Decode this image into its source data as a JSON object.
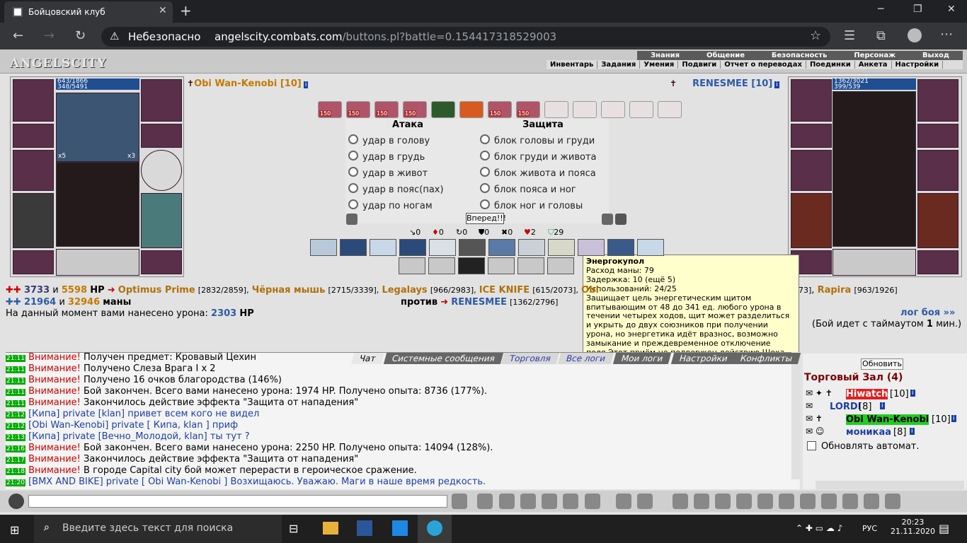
{
  "browser": {
    "tab_title": "Бойцовский клуб",
    "omnibox_security": "Небезопасно",
    "url_host": "angelscity.combats.com",
    "url_path": "/buttons.pl?battle=0.154417318529003"
  },
  "game": {
    "logo": "ANGELSCITY",
    "menu_top": [
      "Знания",
      "Общение",
      "Безопасность",
      "Персонаж",
      "Выход"
    ],
    "menu_sub": [
      "Инвентарь",
      "Задания",
      "Умения",
      "Подвиги",
      "Отчет о переводах",
      "Поединки",
      "Анкета",
      "Настройки"
    ]
  },
  "player": {
    "hp": "643/1866",
    "mana": "348/5491",
    "name": "Obi Wan-Kenobi [10]",
    "slot_count_a": "x5",
    "slot_count_b": "x3"
  },
  "enemy": {
    "hp": "1362/3021",
    "mana": "399/539",
    "name": "RENESMEE [10]"
  },
  "scroll_counts": [
    "150",
    "150",
    "150",
    "150",
    "150",
    "150"
  ],
  "attack": {
    "title": "Атака",
    "options": [
      "удар в голову",
      "удар в грудь",
      "удар в живот",
      "удар в пояс(пах)",
      "удар по ногам"
    ]
  },
  "defense": {
    "title": "Защита",
    "options": [
      "блок головы и груди",
      "блок груди и живота",
      "блок живота и пояса",
      "блок пояса и ног",
      "блок ног и головы"
    ]
  },
  "go_button": "Вперед!!!",
  "stats": [
    "0",
    "0",
    "0",
    "0",
    "0",
    "2",
    "29"
  ],
  "tooltip": {
    "title": "Энергокупол",
    "mana": "Расход маны: 79",
    "delay": "Задержка: 10 (ещё 5)",
    "uses": "Использований: 24/25",
    "desc": "Защищает цель энергетическим щитом впитывающим от 48 до 341 ед. любого урона в течении четырех ходов, щит может разделиться и укрыть до двух союзников при получении урона, но энергетика идёт вразнос, возможно замыкание и преждевременное отключение поля.Этот приём не подвержен действию Шока."
  },
  "team": {
    "hp_sum": "3733",
    "hp_sum2": "5598",
    "hp_unit": "HP",
    "mana_sum": "21964",
    "mana_sum2": "32946",
    "mana_unit": "маны",
    "and": "и",
    "members": [
      {
        "n": "Optimus Prime",
        "v": "[2832/2859],"
      },
      {
        "n": "Чёрная мышь",
        "v": "[2715/3339],"
      },
      {
        "n": "Legalays",
        "v": "[966/2983],"
      },
      {
        "n": "ICE KNIFE",
        "v": "[615/2073],"
      },
      {
        "n": "Obi",
        "v": ""
      }
    ],
    "right_tail": "73]",
    "right_member": "Rapira",
    "right_member_v": "[963/1926]",
    "vs_label": "против",
    "vs_name": "RENESMEE",
    "vs_val": "[1362/2796]",
    "dmg_text": "На данный момент вами нанесено урона:",
    "dmg_val": "2303",
    "dmg_unit": "HP",
    "log_link": "лог боя »»",
    "timeout_pre": "(Бой идет с таймаутом",
    "timeout_val": "1",
    "timeout_post": "мин.)"
  },
  "chat_tabs": [
    "Чат",
    "Системные сообщения",
    "Торговля",
    "Все логи",
    "Мои логи",
    "Настройки",
    "Конфликты"
  ],
  "chat": [
    {
      "t": "21:11",
      "w": "Внимание!",
      "m": "Получен предмет: Кровавый Цехин"
    },
    {
      "t": "21:11",
      "w": "Внимание!",
      "m": "Получено Слеза Врага I x 2"
    },
    {
      "t": "21:11",
      "w": "Внимание!",
      "m": "Получено 16 очков благородства (146%)"
    },
    {
      "t": "21:11",
      "w": "Внимание!",
      "m": "Бой закончен. Всего вами нанесено урона: 1974 HP. Получено опыта: 8736 (177%)."
    },
    {
      "t": "21:11",
      "w": "Внимание!",
      "m": "Закончилось действие эффекта \"Защита от нападения\""
    },
    {
      "t": "21:12",
      "w": "",
      "m": "[Кипа] private [klan] привет всем кого не видел"
    },
    {
      "t": "21:12",
      "w": "",
      "m": "[Obi Wan-Kenobi] private [ Кипа, klan ] приф"
    },
    {
      "t": "21:13",
      "w": "",
      "m": "[Кипа] private [Вечно_Молодой, klan] ты тут ?"
    },
    {
      "t": "21:16",
      "w": "Внимание!",
      "m": "Бой закончен. Всего вами нанесено урона: 2250 HP. Получено опыта: 14094 (128%)."
    },
    {
      "t": "21:17",
      "w": "Внимание!",
      "m": "Закончилось действие эффекта \"Защита от нападения\""
    },
    {
      "t": "21:18",
      "w": "Внимание!",
      "m": "В городе Capital city бой может перерасти в героическое сражение."
    },
    {
      "t": "21:20",
      "w": "",
      "m": "[BMX AND BIKE] private [ Obi Wan-Kenobi ] Возхищаюсь. Уважаю. Маги в наше время редкость."
    }
  ],
  "room": {
    "refresh": "Обновить",
    "title": "Торговый Зал (4)",
    "users": [
      {
        "n": "Hiwatch",
        "l": "[10]"
      },
      {
        "n": "LORDI",
        "l": "[8]"
      },
      {
        "n": "Obi Wan-Kenobi",
        "l": "[10]"
      },
      {
        "n": "моникаа",
        "l": "[8]"
      }
    ],
    "auto": "Обновлять автомат."
  },
  "taskbar": {
    "search": "Введите здесь текст для поиска",
    "lang": "РУС",
    "time": "20:23",
    "date": "21.11.2020"
  },
  "colors": {
    "accent": "#2e5aa8",
    "warn": "#cc0000",
    "tab_green": "#00aa00"
  }
}
